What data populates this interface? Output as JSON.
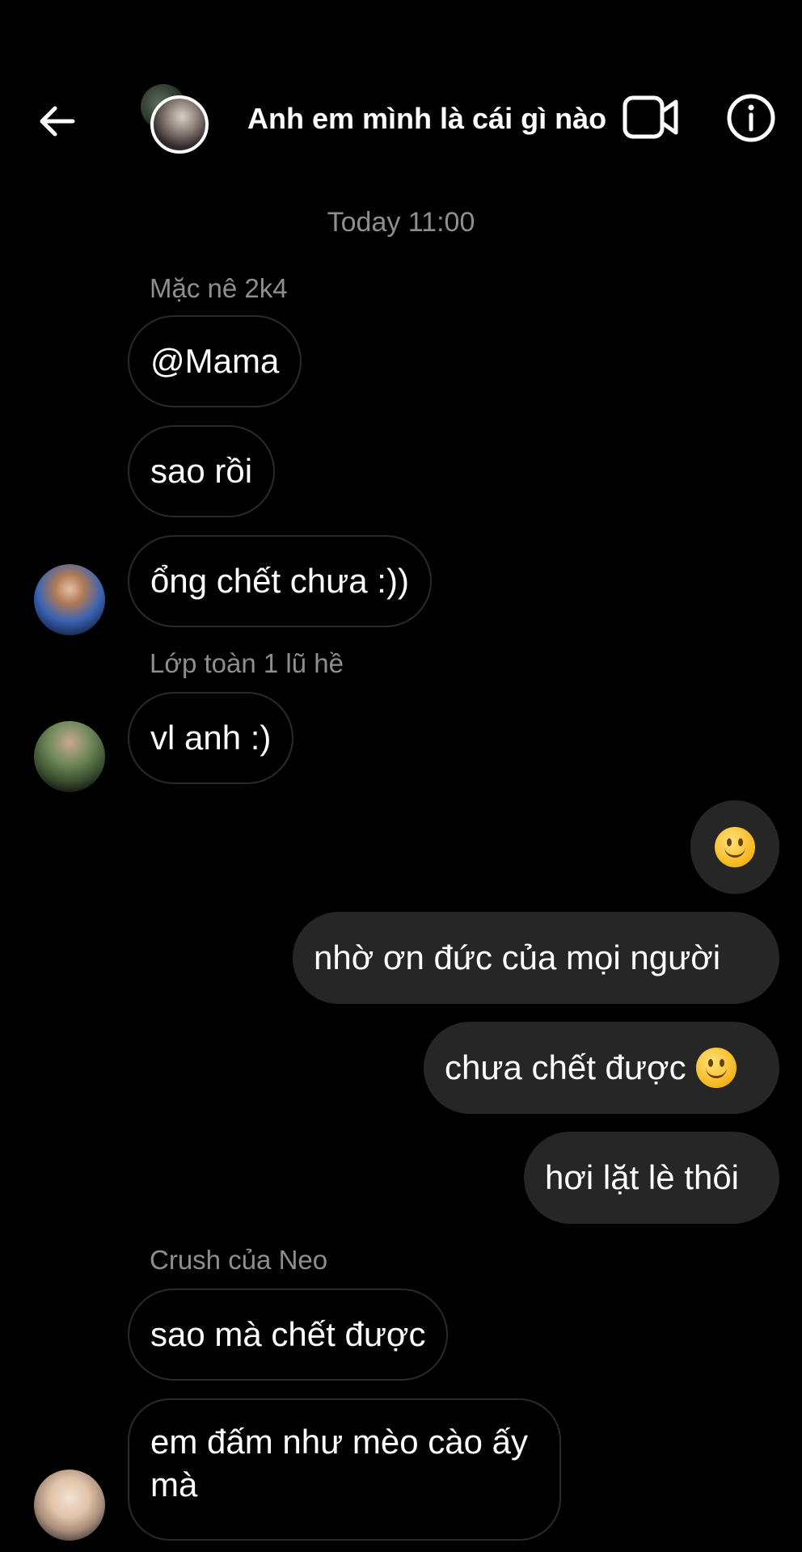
{
  "header": {
    "title": "Anh em mình là cái gì nào",
    "back_icon": "arrow-left-icon",
    "video_icon": "video-camera-icon",
    "info_icon": "info-icon"
  },
  "timestamp": "Today 11:00",
  "messages": [
    {
      "sender": "Mặc nê 2k4",
      "text": "@Mama",
      "direction": "incoming"
    },
    {
      "text": "sao rồi",
      "direction": "incoming"
    },
    {
      "text": "ổng chết chưa :))",
      "direction": "incoming"
    },
    {
      "sender": "Lớp toàn 1 lũ hề",
      "text": "vl anh :)",
      "direction": "incoming"
    },
    {
      "emoji": "slightly-smiling-face",
      "direction": "outgoing"
    },
    {
      "text": "nhờ ơn đức của mọi người",
      "direction": "outgoing"
    },
    {
      "text": "chưa chết được",
      "emoji": "slightly-smiling-face",
      "direction": "outgoing"
    },
    {
      "text": "hơi lặt lè thôi",
      "direction": "outgoing"
    },
    {
      "sender": "Crush của Neo",
      "text": "sao mà chết được",
      "direction": "incoming"
    },
    {
      "text": "em đấm như mèo cào ấy mà",
      "direction": "incoming"
    }
  ],
  "colors": {
    "background": "#000000",
    "outgoing_bubble": "#262626",
    "incoming_border": "#2a2a2a",
    "muted_text": "#8e8e8e"
  }
}
